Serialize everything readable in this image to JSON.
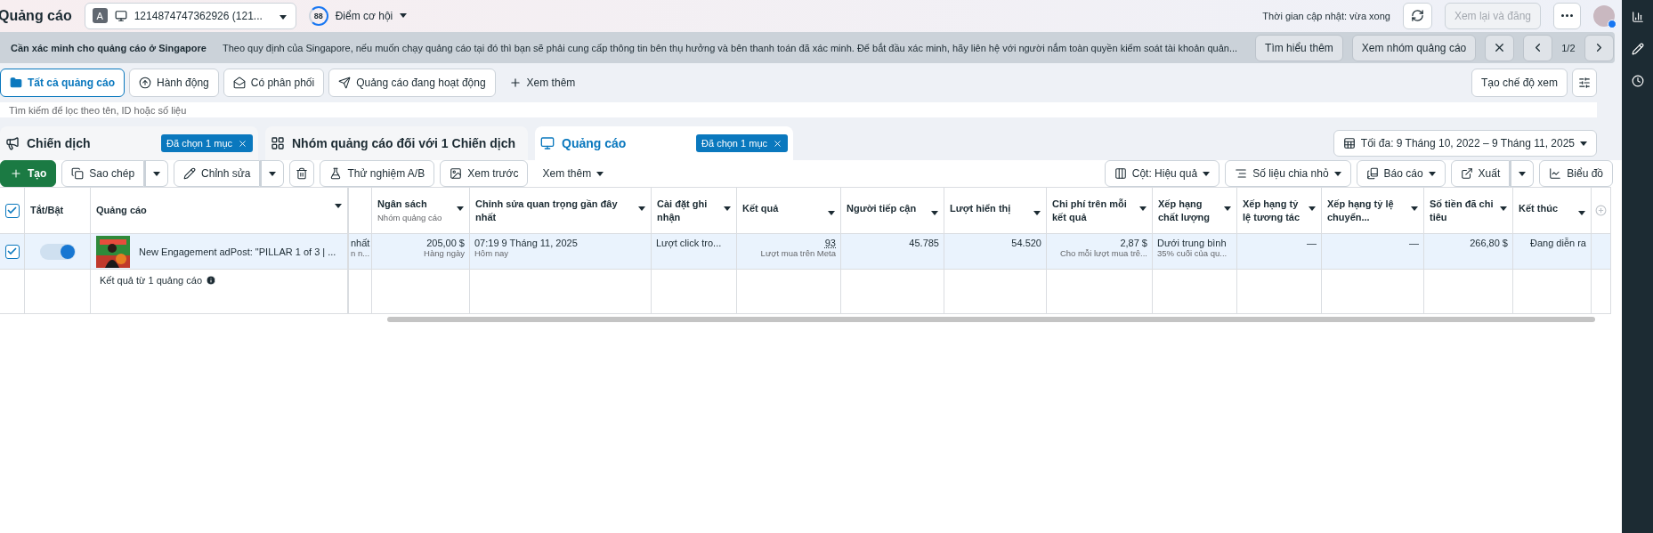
{
  "topbar": {
    "title": "Quảng cáo",
    "account": {
      "badge": "A",
      "id": "1214874747362926 (121..."
    },
    "score": {
      "value": "88",
      "label": "Điểm cơ hội"
    },
    "update_time": "Thời gian cập nhật: vừa xong",
    "review_button": {
      "label": "Xem lại và đăng",
      "disabled": true
    }
  },
  "banner": {
    "title": "Cần xác minh cho quảng cáo ở Singapore",
    "message": "Theo quy định của Singapore, nếu muốn chạy quảng cáo tại đó thì bạn sẽ phải cung cấp thông tin bên thụ hưởng và bên thanh toán đã xác minh. Để bắt đầu xác minh, hãy liên hệ với người nắm toàn quyền kiểm soát tài khoản quản...",
    "buttons": [
      "Tìm hiểu thêm",
      "Xem nhóm quảng cáo"
    ],
    "pager": "1/2"
  },
  "filters": [
    {
      "label": "Tất cả quảng cáo",
      "selected": true
    },
    {
      "label": "Hành động",
      "selected": false
    },
    {
      "label": "Có phân phối",
      "selected": false
    },
    {
      "label": "Quảng cáo đang hoạt động",
      "selected": false
    }
  ],
  "filters_more": "Xem thêm",
  "view_button": "Tạo chế độ xem",
  "search": {
    "placeholder": "Tìm kiếm để lọc theo tên, ID hoặc số liệu"
  },
  "level_tabs": [
    {
      "label": "Chiến dịch",
      "selected": false,
      "badge": "Đã chọn 1 mục"
    },
    {
      "label": "Nhóm quảng cáo đối với 1 Chiến dịch",
      "selected": false
    },
    {
      "label": "Quảng cáo",
      "selected": true,
      "badge": "Đã chọn 1 mục"
    }
  ],
  "date_range": "Tối đa: 9 Tháng 10, 2022 – 9 Tháng 11, 2025",
  "toolbar_left": [
    {
      "kind": "primary",
      "label": "Tạo"
    },
    {
      "kind": "split",
      "label": "Sao chép"
    },
    {
      "kind": "split",
      "label": "Chỉnh sửa"
    },
    {
      "kind": "icon"
    },
    {
      "kind": "button",
      "label": "Thử nghiệm A/B"
    },
    {
      "kind": "button",
      "label": "Xem trước"
    },
    {
      "kind": "menu",
      "label": "Xem thêm"
    }
  ],
  "toolbar_right": [
    {
      "kind": "dropdown",
      "label": "Cột: Hiệu quả"
    },
    {
      "kind": "dropdown",
      "label": "Số liệu chia nhỏ"
    },
    {
      "kind": "dropdown",
      "label": "Báo cáo"
    },
    {
      "kind": "split",
      "label": "Xuất"
    },
    {
      "kind": "button",
      "label": "Biểu đồ"
    }
  ],
  "table": {
    "toggle_header": "Tắt/Bật",
    "name_header": "Quảng cáo",
    "all_checked": true,
    "columns": [
      {
        "kind": "text"
      },
      {
        "label": "Ngân sách",
        "sublabel": "Nhóm quảng cáo",
        "kind": "number"
      },
      {
        "label": "Chỉnh sửa quan trọng gần đây nhất",
        "kind": "text"
      },
      {
        "label": "Cài đặt ghi nhận",
        "kind": "text"
      },
      {
        "label": "Kết quả",
        "kind": "result"
      },
      {
        "label": "Người tiếp cận",
        "kind": "number"
      },
      {
        "label": "Lượt hiển thị",
        "kind": "number"
      },
      {
        "label": "Chi phí trên mỗi kết quả",
        "kind": "number"
      },
      {
        "label": "Xếp hạng chất lượng",
        "kind": "text"
      },
      {
        "label": "Xếp hạng tỷ lệ tương tác",
        "kind": "number"
      },
      {
        "label": "Xếp hạng tỷ lệ chuyển...",
        "kind": "number"
      },
      {
        "label": "Số tiền đã chi tiêu",
        "kind": "number"
      },
      {
        "label": "Kết thúc",
        "kind": "number"
      }
    ],
    "rows": [
      {
        "checked": true,
        "on": true,
        "name": "New Engagement adPost: \"PILLAR 1 of 3 | ...",
        "cells": [
          {
            "text": "nhất",
            "sub": "n n..."
          },
          {
            "text": "205,00 $",
            "sub": "Hàng ngày"
          },
          {
            "text": "07:19 9 Tháng 11, 2025",
            "sub": "Hôm nay"
          },
          {
            "text": "Lượt click tro..."
          },
          {
            "text": "93",
            "sub": "Lượt mua trên Meta"
          },
          {
            "text": "45.785"
          },
          {
            "text": "54.520"
          },
          {
            "text": "2,87 $",
            "sub": "Cho mỗi lượt mua trê..."
          },
          {
            "text": "Dưới trung bình",
            "sub": "35% cuối của qu..."
          },
          {
            "text": "—"
          },
          {
            "text": "—"
          },
          {
            "text": "266,80 $"
          },
          {
            "text": "Đang diễn ra"
          }
        ]
      }
    ],
    "summary": "Kết quả từ 1 quảng cáo"
  }
}
